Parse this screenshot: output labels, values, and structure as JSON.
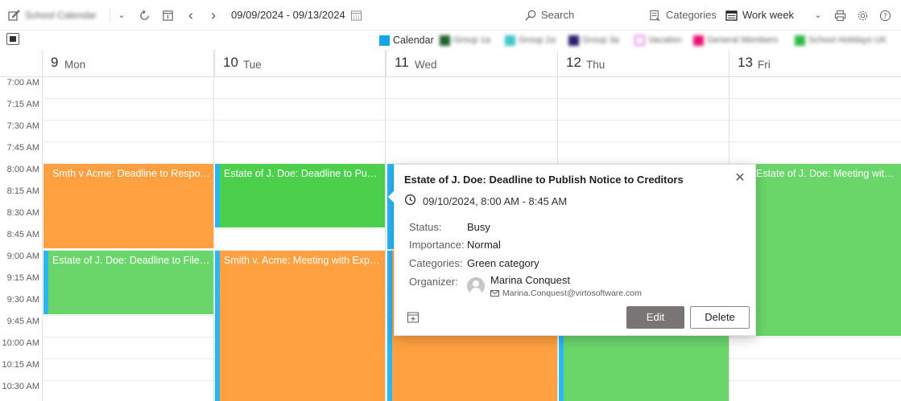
{
  "toolbar": {
    "calendar_name": "School Calendar",
    "date_range": "09/09/2024 - 09/13/2024",
    "search_placeholder": "Search",
    "categories_label": "Categories",
    "view_label": "Work week"
  },
  "legend": [
    {
      "label": "Calendar",
      "color": "#13a6e8",
      "blurred": false
    },
    {
      "label": "Group 1a",
      "color": "#1f5e2d",
      "blurred": true
    },
    {
      "label": "Group 2a",
      "color": "#3fc6c9",
      "blurred": true
    },
    {
      "label": "Group 3a",
      "color": "#2d1b6b",
      "blurred": true
    },
    {
      "label": "Vacation",
      "color": "#e87ee8",
      "blurred": true,
      "outline": true
    },
    {
      "label": "General Members",
      "color": "#e8136f",
      "blurred": true
    },
    {
      "label": "School Holidays UK",
      "color": "#2fb84a",
      "blurred": true
    }
  ],
  "days": [
    {
      "num": "9",
      "name": "Mon"
    },
    {
      "num": "10",
      "name": "Tue"
    },
    {
      "num": "11",
      "name": "Wed"
    },
    {
      "num": "12",
      "name": "Thu"
    },
    {
      "num": "13",
      "name": "Fri"
    }
  ],
  "times": [
    "7:00 AM",
    "7:15 AM",
    "7:30 AM",
    "7:45 AM",
    "8:00 AM",
    "8:15 AM",
    "8:30 AM",
    "8:45 AM",
    "9:00 AM",
    "9:15 AM",
    "9:30 AM",
    "9:45 AM",
    "10:00 AM",
    "10:15 AM",
    "10:30 AM"
  ],
  "events": [
    {
      "title": "Smth v Acme: Deadline to Respon...",
      "color": "#ffa040",
      "bar": "#ffa040"
    },
    {
      "title": "Estate of J. Doe: Deadline to Publi...",
      "color": "#4cd04c",
      "bar": "#29b6f6"
    },
    {
      "title": "Estate of J. Doe: Deadline to File ...",
      "color": "#6ad66a",
      "bar": "#29b6f6"
    },
    {
      "title": "Smith v. Acme: Meeting with Expe...",
      "color": "#ffa040",
      "bar": "#29b6f6"
    },
    {
      "title": "",
      "color": "#ffa040",
      "bar": "#29b6f6"
    },
    {
      "title": "",
      "color": "#6ad66a",
      "bar": "#29b6f6"
    },
    {
      "title": "Estate of J. Doe: Meeting with Ben...",
      "color": "#6ad66a",
      "bar": "#29b6f6"
    },
    {
      "title": "",
      "color": "#29b6f6",
      "bar": "#29b6f6"
    }
  ],
  "popup": {
    "title": "Estate of J. Doe: Deadline to Publish Notice to Creditors",
    "datetime": "09/10/2024, 8:00 AM - 8:45 AM",
    "status_label": "Status:",
    "status_value": "Busy",
    "importance_label": "Importance:",
    "importance_value": "Normal",
    "categories_label": "Categories:",
    "categories_value": "Green category",
    "organizer_label": "Organizer:",
    "organizer_name": "Marina Conquest",
    "organizer_email": "Marina.Conquest@virtosoftware.com",
    "edit_label": "Edit",
    "delete_label": "Delete"
  }
}
